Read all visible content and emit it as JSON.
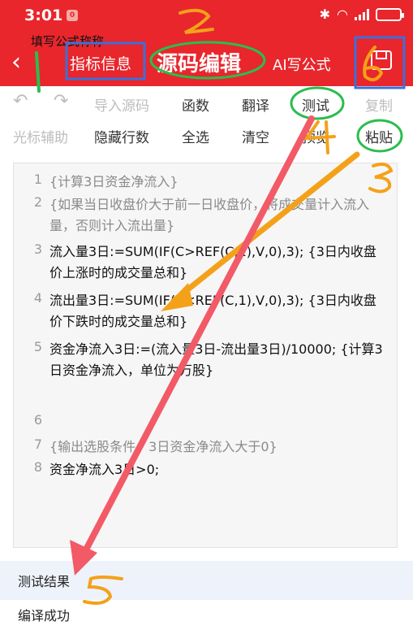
{
  "status_bar": {
    "time": "3:01",
    "app_badge": "0"
  },
  "header": {
    "hint_text": "填写公式称称",
    "indicator_button": "指标信息",
    "source_edit_button": "源码编辑",
    "ai_formula_button": "AI写公式"
  },
  "toolbar": {
    "row1": [
      "导入源码",
      "函数",
      "翻译",
      "测试",
      "复制"
    ],
    "row2": [
      "光标辅助",
      "隐藏行数",
      "全选",
      "清空",
      "预览",
      "粘贴"
    ]
  },
  "editor": {
    "line_numbers": [
      "1",
      "2",
      "3",
      "4",
      "5",
      "6",
      "7",
      "8"
    ],
    "lines": [
      "{计算3日资金净流入}",
      "{如果当日收盘价大于前一日收盘价，将成交量计入流入量，否则计入流出量}",
      "流入量3日:=SUM(IF(C>REF(C,1),V,0),3); {3日内收盘价上涨时的成交量总和}",
      "流出量3日:=SUM(IF(C<REF(C,1),V,0),3); {3日内收盘价下跌时的成交量总和}",
      "资金净流入3日:=(流入量3日-流出量3日)/10000; {计算3日资金净流入，单位为万股}",
      "",
      "{输出选股条件，3日资金净流入大于0}",
      "资金净流入3日>0;"
    ]
  },
  "result": {
    "title": "测试结果",
    "message": "编译成功"
  },
  "annotations": [
    "1",
    "2",
    "3",
    "4",
    "5",
    "6"
  ],
  "colors": {
    "header_red": "#e8262c",
    "annotation_green": "#2bbd4e",
    "annotation_blue": "#3d6fd8",
    "annotation_orange": "#f4a11a",
    "arrow_red": "#f25a67"
  }
}
